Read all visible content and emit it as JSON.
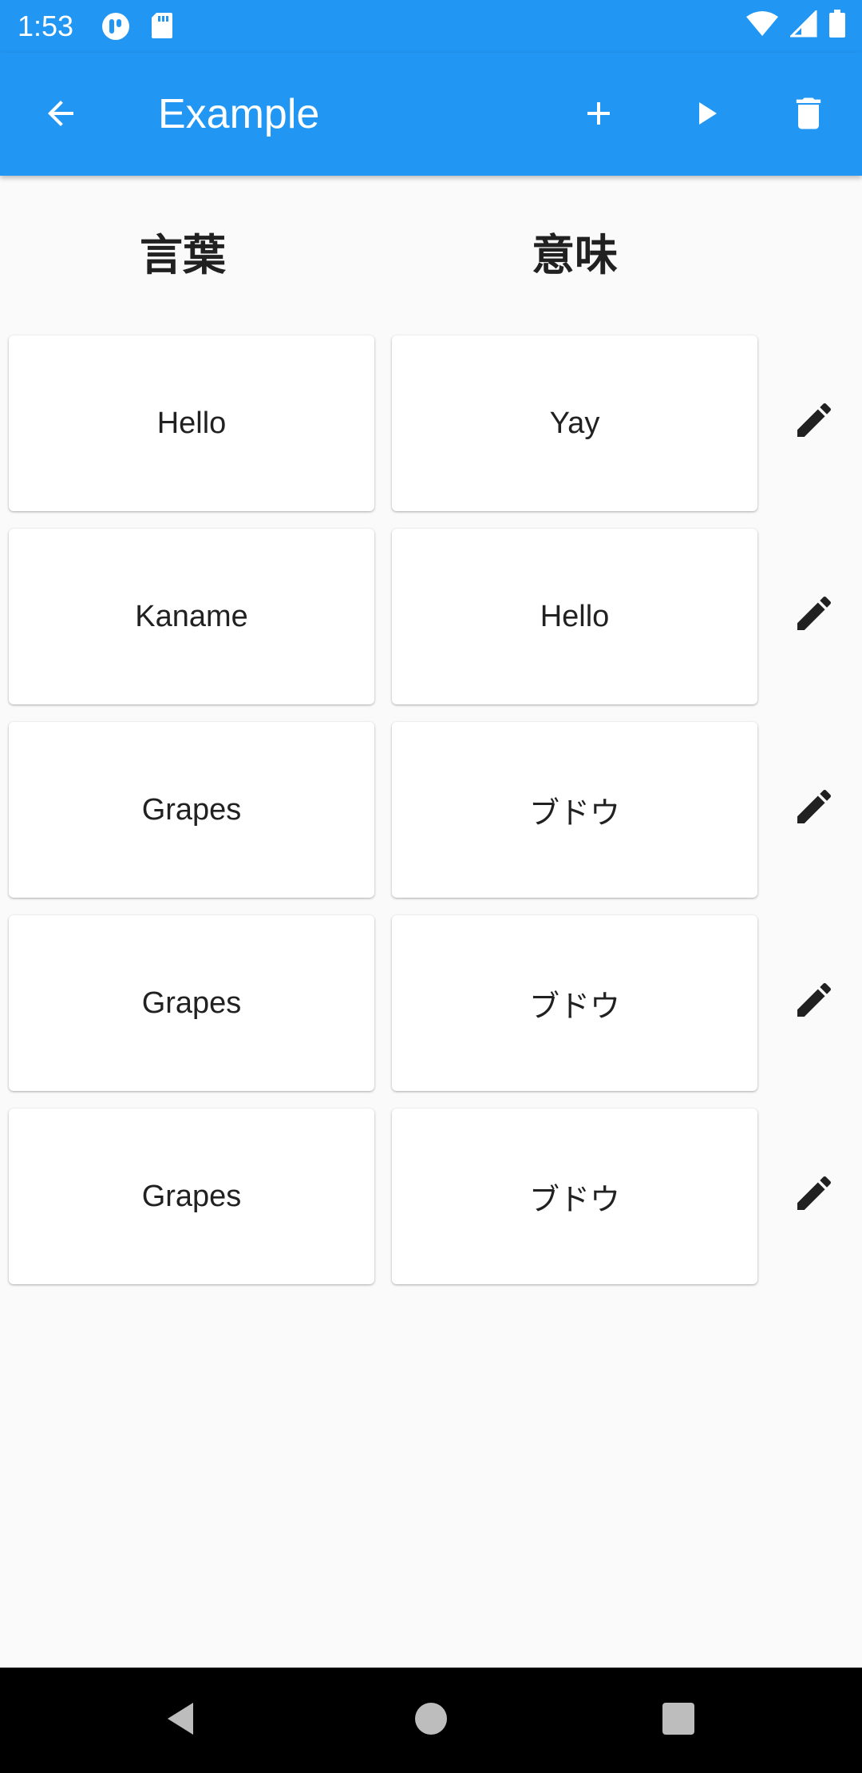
{
  "status_bar": {
    "time": "1:53"
  },
  "app_bar": {
    "title": "Example"
  },
  "columns": {
    "word": "言葉",
    "meaning": "意味"
  },
  "rows": [
    {
      "word": "Hello",
      "meaning": "Yay"
    },
    {
      "word": "Kaname",
      "meaning": "Hello"
    },
    {
      "word": "Grapes",
      "meaning": "ブドウ"
    },
    {
      "word": "Grapes",
      "meaning": "ブドウ"
    },
    {
      "word": "Grapes",
      "meaning": "ブドウ"
    }
  ],
  "colors": {
    "primary": "#2196f3",
    "background": "#fafafa",
    "card": "#ffffff",
    "text": "#212121"
  },
  "icons": {
    "app_bar": [
      "arrow-back-icon",
      "add-icon",
      "play-icon",
      "delete-icon"
    ],
    "row_action": "edit-pencil-icon",
    "nav": [
      "nav-back-icon",
      "nav-home-icon",
      "nav-recents-icon"
    ]
  }
}
